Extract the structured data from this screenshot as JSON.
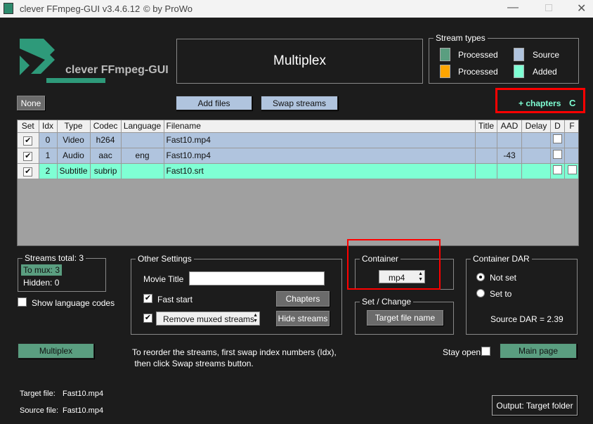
{
  "window": {
    "title": "clever FFmpeg-GUI v3.4.6.12",
    "copyright": "© by ProWo"
  },
  "logo": {
    "text": "clever FFmpeg-GUI"
  },
  "header": {
    "title": "Multiplex"
  },
  "stream_types": {
    "legend": "Stream types",
    "items": [
      {
        "label": "Processed",
        "color": "#5a9e80"
      },
      {
        "label": "Source",
        "color": "#b0c4de"
      },
      {
        "label": "Processed",
        "color": "#ffa500"
      },
      {
        "label": "Added",
        "color": "#7fffd4"
      }
    ]
  },
  "toolbar": {
    "none": "None",
    "add_files": "Add files",
    "swap_streams": "Swap streams",
    "chapters_indicator": "+ chapters",
    "chapters_letter": "C"
  },
  "table": {
    "columns": [
      "Set",
      "Idx",
      "Type",
      "Codec",
      "Language",
      "Filename",
      "Title",
      "AAD",
      "Delay",
      "D",
      "F"
    ],
    "rows": [
      {
        "set": true,
        "idx": "0",
        "type": "Video",
        "codec": "h264",
        "language": "",
        "filename": "Fast10.mp4",
        "title": "",
        "aad": "",
        "delay": "",
        "d": false,
        "f": null,
        "color": "#b0c4de"
      },
      {
        "set": true,
        "idx": "1",
        "type": "Audio",
        "codec": "aac",
        "language": "eng",
        "filename": "Fast10.mp4",
        "title": "",
        "aad": "-43",
        "delay": "",
        "d": false,
        "f": null,
        "color": "#b0c4de"
      },
      {
        "set": true,
        "idx": "2",
        "type": "Subtitle",
        "codec": "subrip",
        "language": "",
        "filename": "Fast10.srt",
        "title": "",
        "aad": "",
        "delay": "",
        "d": false,
        "f": false,
        "color": "#7fffd4"
      }
    ]
  },
  "streams": {
    "total": "Streams total:  3",
    "to_mux": "To mux:  3",
    "hidden": "Hidden:  0",
    "show_codes": "Show language codes"
  },
  "other": {
    "legend": "Other Settings",
    "movie_title_label": "Movie Title",
    "movie_title": "",
    "fast_start": "Fast start",
    "remove_option": "Remove muxed streams",
    "chapters": "Chapters",
    "hide_streams": "Hide streams"
  },
  "container": {
    "legend": "Container",
    "value": "mp4"
  },
  "set_change": {
    "legend": "Set / Change",
    "target_file_name": "Target file name"
  },
  "dar": {
    "legend": "Container DAR",
    "not_set": "Not set",
    "set_to": "Set to",
    "source_dar": "Source DAR = 2.39"
  },
  "footer": {
    "multiplex": "Multiplex",
    "hint1": "To reorder the streams, first swap index numbers (Idx),",
    "hint2": " then click Swap streams button.",
    "stay_open": "Stay open",
    "main_page": "Main page",
    "target_label": "Target file:",
    "target_value": "Fast10.mp4",
    "source_label": "Source file:",
    "source_value": "Fast10.mp4",
    "output": "Output: Target folder"
  }
}
